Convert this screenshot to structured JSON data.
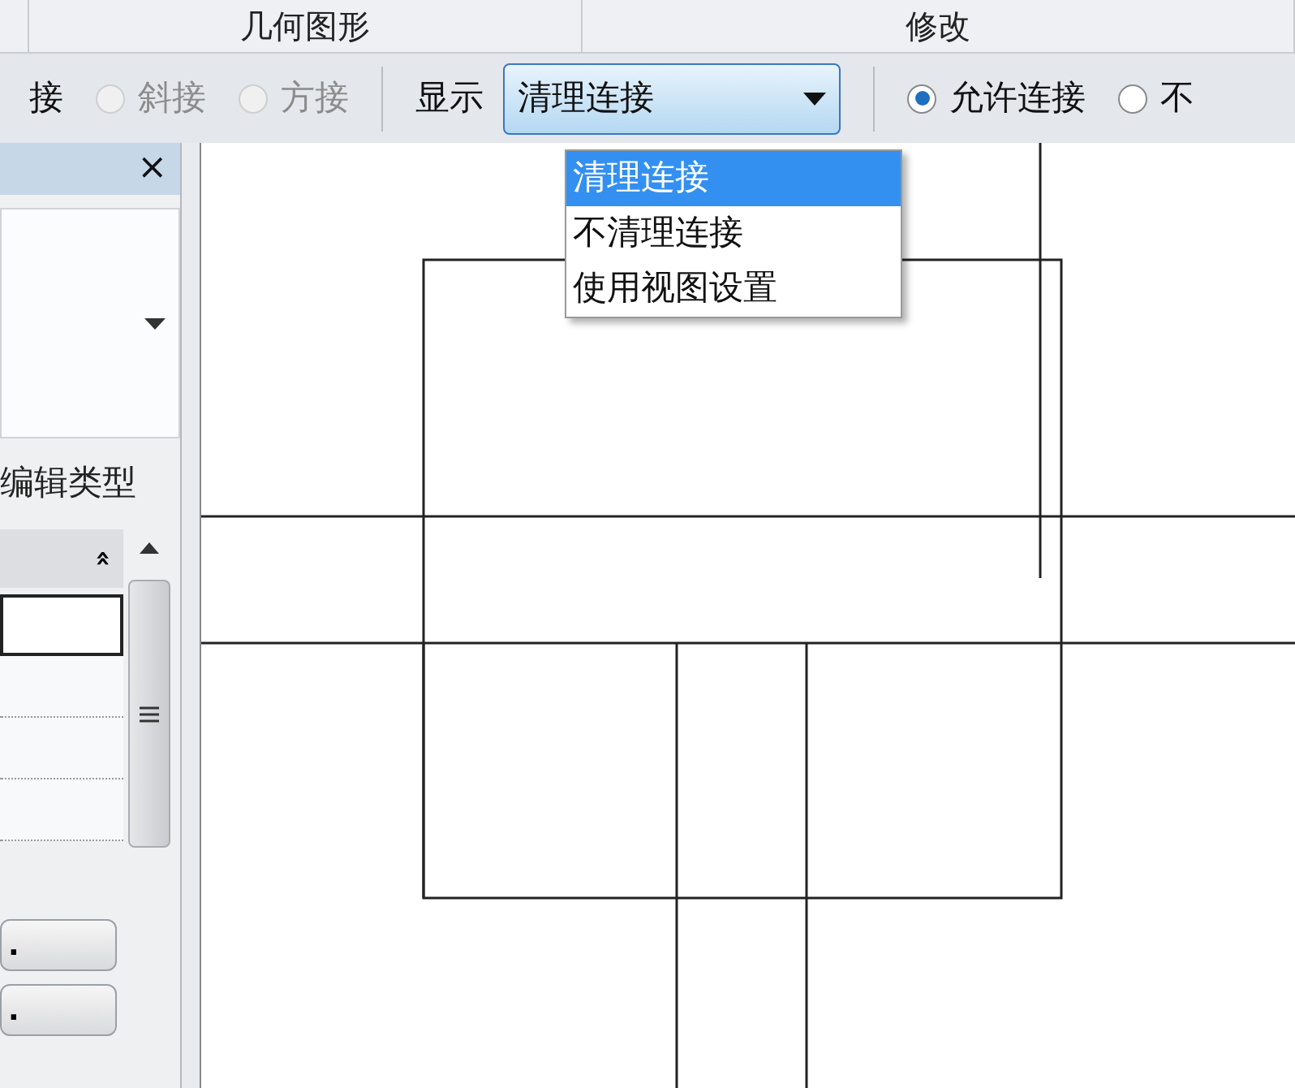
{
  "ribbon_panels": [
    {
      "label": "几何图形"
    },
    {
      "label": "修改"
    }
  ],
  "options_bar": {
    "join_options": [
      {
        "label": "接",
        "disabled": false
      },
      {
        "label": "斜接",
        "selected": false,
        "disabled": true
      },
      {
        "label": "方接",
        "selected": false,
        "disabled": true
      }
    ],
    "display_label": "显示",
    "display_value": "清理连接",
    "display_menu": [
      {
        "label": "清理连接",
        "selected": true
      },
      {
        "label": "不清理连接",
        "selected": false
      },
      {
        "label": "使用视图设置",
        "selected": false
      }
    ],
    "allow_options": [
      {
        "label": "允许连接",
        "selected": true
      },
      {
        "label": "不",
        "selected": false
      }
    ]
  },
  "properties": {
    "close": "×",
    "edit_type": "编辑类型",
    "collapse": "»",
    "rows": [
      {
        "selected": true
      },
      {
        "selected": false
      },
      {
        "selected": false
      },
      {
        "selected": false
      }
    ],
    "buttons": [
      ".",
      "."
    ]
  }
}
